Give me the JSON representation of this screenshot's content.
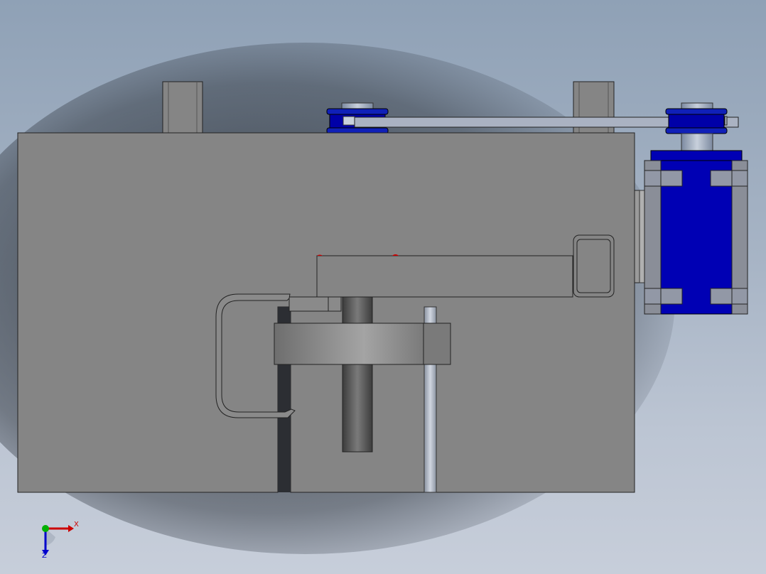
{
  "viewport": {
    "background_top": "#8fa1b6",
    "background_bottom": "#c7ceda",
    "part_color": "#858585",
    "motor_color": "#0000b4",
    "accent_color": "#cc0000"
  },
  "triad": {
    "x_label": "X",
    "z_label": "Z",
    "x_color": "#cc0000",
    "y_color": "#00b000",
    "z_color": "#0000cc"
  }
}
